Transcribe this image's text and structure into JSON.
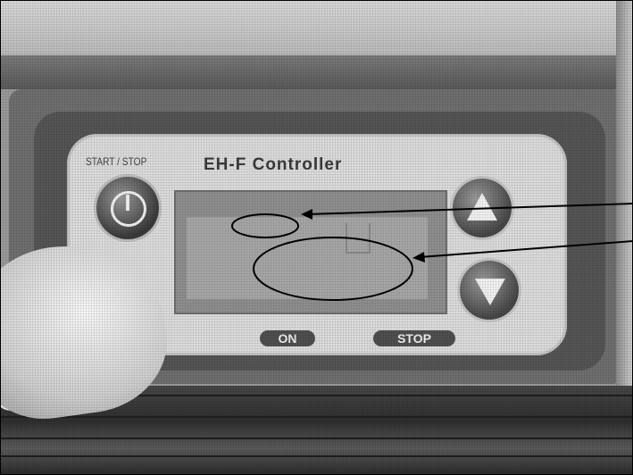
{
  "panel": {
    "title": "EH-F Controller",
    "start_stop_label": "START / STOP",
    "on_label": "ON",
    "stop_label": "STOP"
  },
  "icons": {
    "power": "power-icon",
    "up": "up-arrow-icon",
    "down": "down-arrow-icon"
  },
  "colors": {
    "panel": "#dcdcdc",
    "housing": "#6f6f6f",
    "lcd": "#8f8f8f",
    "buttons": "#474747"
  }
}
